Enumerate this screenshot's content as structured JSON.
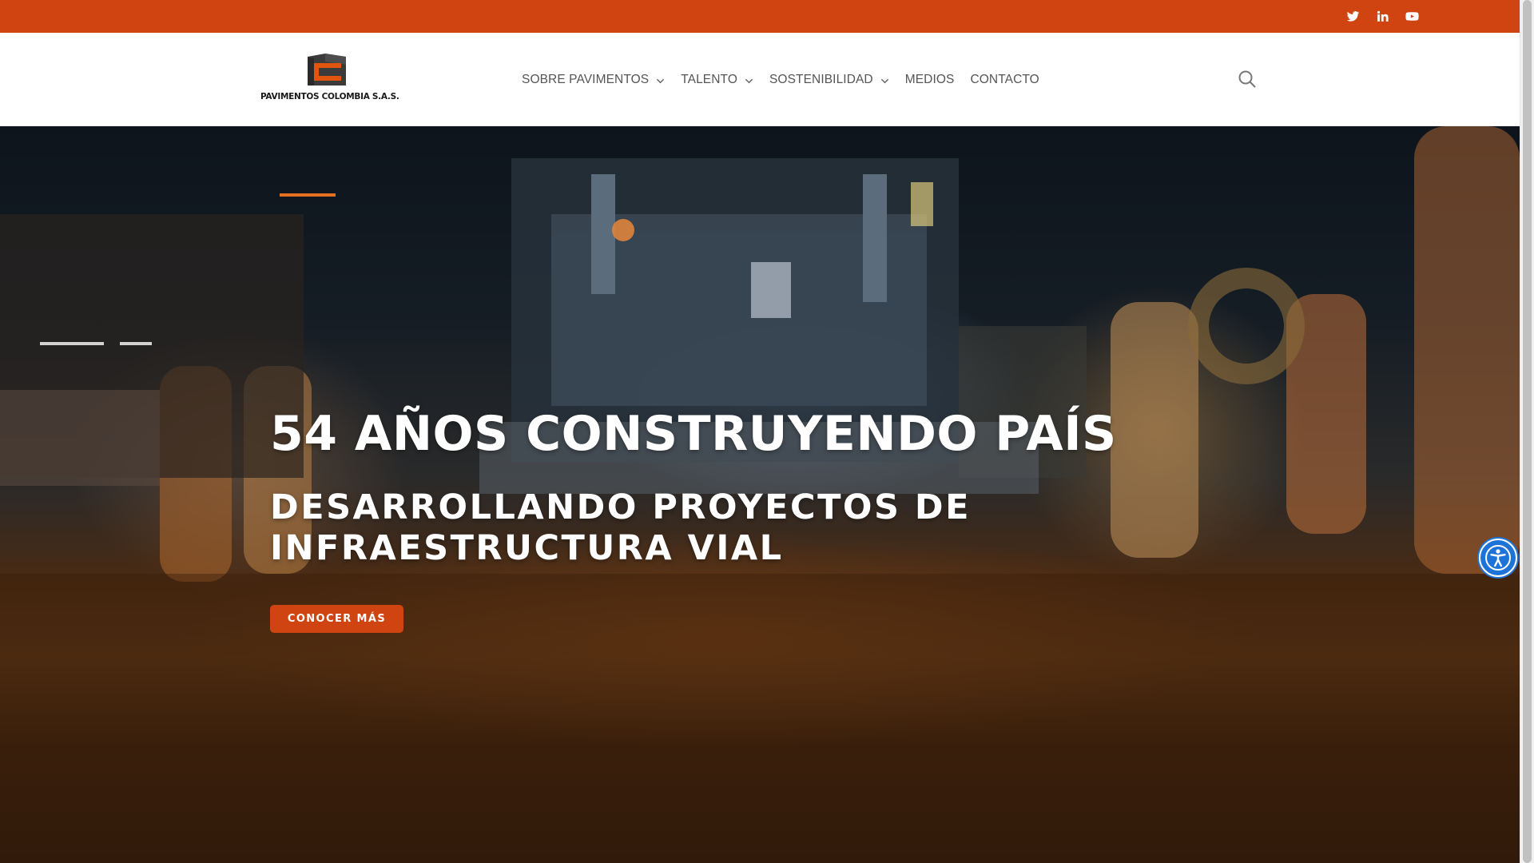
{
  "topbar": {
    "social": [
      {
        "icon": "twitter-icon"
      },
      {
        "icon": "linkedin-icon"
      },
      {
        "icon": "youtube-icon"
      }
    ]
  },
  "header": {
    "logo_text": "PAVIMENTOS COLOMBIA S.A.S.",
    "nav": [
      {
        "label": "SOBRE PAVIMENTOS",
        "dropdown": true
      },
      {
        "label": "TALENTO",
        "dropdown": true
      },
      {
        "label": "SOSTENIBILIDAD",
        "dropdown": true
      },
      {
        "label": "MEDIOS",
        "dropdown": false
      },
      {
        "label": "CONTACTO",
        "dropdown": false
      }
    ],
    "search_icon": "search-icon"
  },
  "hero": {
    "title": "54 AÑOS CONSTRUYENDO PAÍS",
    "subtitle": "DESARROLLANDO PROYECTOS DE INFRAESTRUCTURA VIAL",
    "button": "CONOCER MÁS"
  },
  "accessibility": {
    "icon": "accessibility-icon"
  },
  "colors": {
    "brand": "#cf4410",
    "accessibility": "#1e73d8",
    "nav_text": "#555555"
  }
}
